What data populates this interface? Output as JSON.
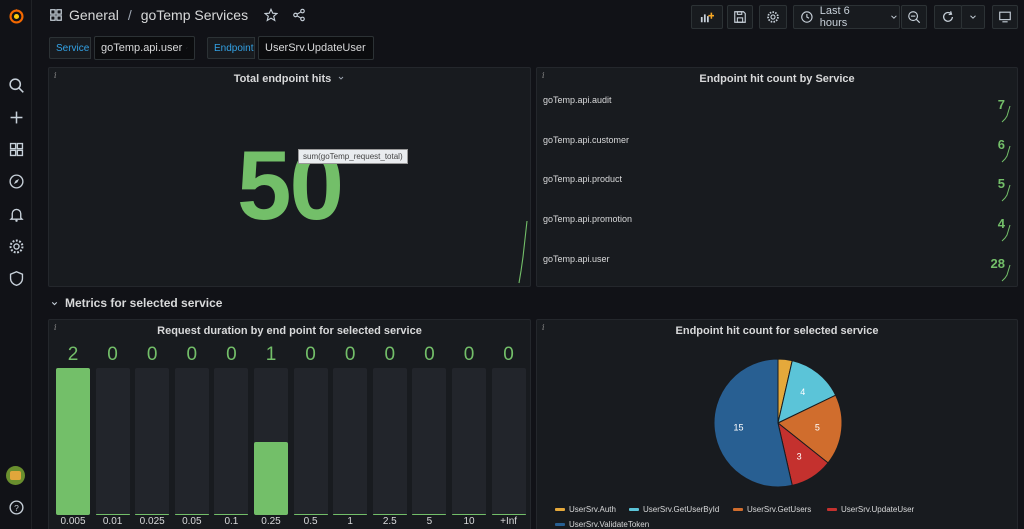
{
  "breadcrumb": {
    "folder": "General",
    "separator": "/",
    "dashboard": "goTemp Services"
  },
  "time_range": {
    "label": "Last 6 hours"
  },
  "variables": [
    {
      "label": "Service",
      "value": "goTemp.api.user"
    },
    {
      "label": "Endpoint",
      "value": "UserSrv.UpdateUser"
    }
  ],
  "panel_total": {
    "title": "Total endpoint hits",
    "value": "50",
    "tooltip": "sum(goTemp_request_total)"
  },
  "panel_services": {
    "title": "Endpoint hit count by Service",
    "rows": [
      {
        "name": "goTemp.api.audit",
        "value": "7"
      },
      {
        "name": "goTemp.api.customer",
        "value": "6"
      },
      {
        "name": "goTemp.api.product",
        "value": "5"
      },
      {
        "name": "goTemp.api.promotion",
        "value": "4"
      },
      {
        "name": "goTemp.api.user",
        "value": "28"
      }
    ]
  },
  "section": {
    "title": "Metrics for selected service"
  },
  "panel_duration": {
    "title": "Request duration by end point for selected service"
  },
  "panel_pie": {
    "title": "Endpoint hit count for selected service"
  },
  "colors": {
    "accent_green": "#73bf69",
    "link_blue": "#33a2e5",
    "bg": "#111217",
    "panel_bg": "#181b1f"
  },
  "chart_data": [
    {
      "type": "bar",
      "title": "Request duration by end point for selected service",
      "categories": [
        "0.005",
        "0.01",
        "0.025",
        "0.05",
        "0.1",
        "0.25",
        "0.5",
        "1",
        "2.5",
        "5",
        "10",
        "+Inf"
      ],
      "values": [
        2,
        0,
        0,
        0,
        0,
        1,
        0,
        0,
        0,
        0,
        0,
        0
      ],
      "ylim": [
        0,
        2
      ]
    },
    {
      "type": "pie",
      "title": "Endpoint hit count for selected service",
      "series": [
        {
          "name": "UserSrv.Auth",
          "value": 1,
          "color": "#e5a93b"
        },
        {
          "name": "UserSrv.GetUserById",
          "value": 4,
          "color": "#5bc4d8"
        },
        {
          "name": "UserSrv.GetUsers",
          "value": 5,
          "color": "#d06d2d"
        },
        {
          "name": "UserSrv.UpdateUser",
          "value": 3,
          "color": "#c4312e"
        },
        {
          "name": "UserSrv.ValidateToken",
          "value": 15,
          "color": "#285f92"
        }
      ],
      "legend": "bottom"
    }
  ]
}
